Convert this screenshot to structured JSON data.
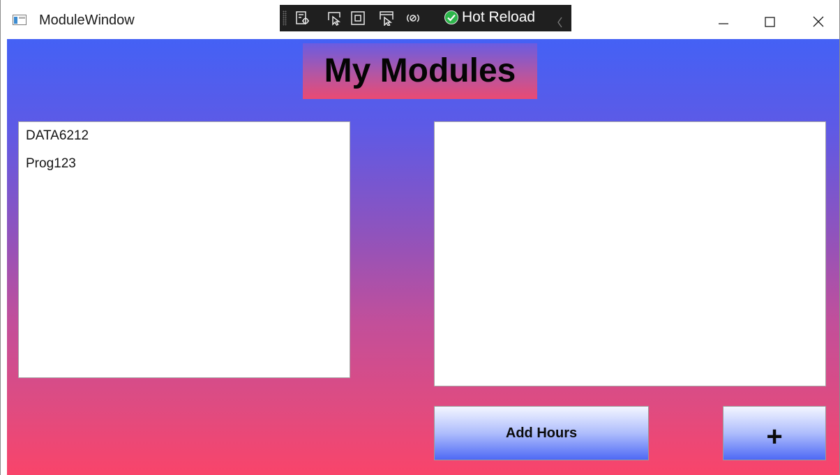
{
  "window": {
    "title": "ModuleWindow",
    "icon": "app-window-icon"
  },
  "devtools": {
    "icons": [
      "live-visual-tree-icon",
      "select-element-icon",
      "display-layout-adorners-icon",
      "track-focus-icon",
      "binding-failures-icon"
    ],
    "hot_reload_label": "Hot Reload",
    "hot_reload_status_icon": "check-circle-icon",
    "collapse_icon": "chevron-left-icon"
  },
  "caption_buttons": [
    "minimize-icon",
    "maximize-icon",
    "close-icon"
  ],
  "main": {
    "heading": "My Modules",
    "modules": [
      "DATA6212",
      "Prog123"
    ],
    "add_hours_label": "Add Hours",
    "plus_label": "+"
  },
  "colors": {
    "gradient_top": "#4461f5",
    "gradient_bottom": "#f9446a",
    "hot_reload_green": "#2db64b",
    "devbar_bg": "#1f1f1f"
  }
}
